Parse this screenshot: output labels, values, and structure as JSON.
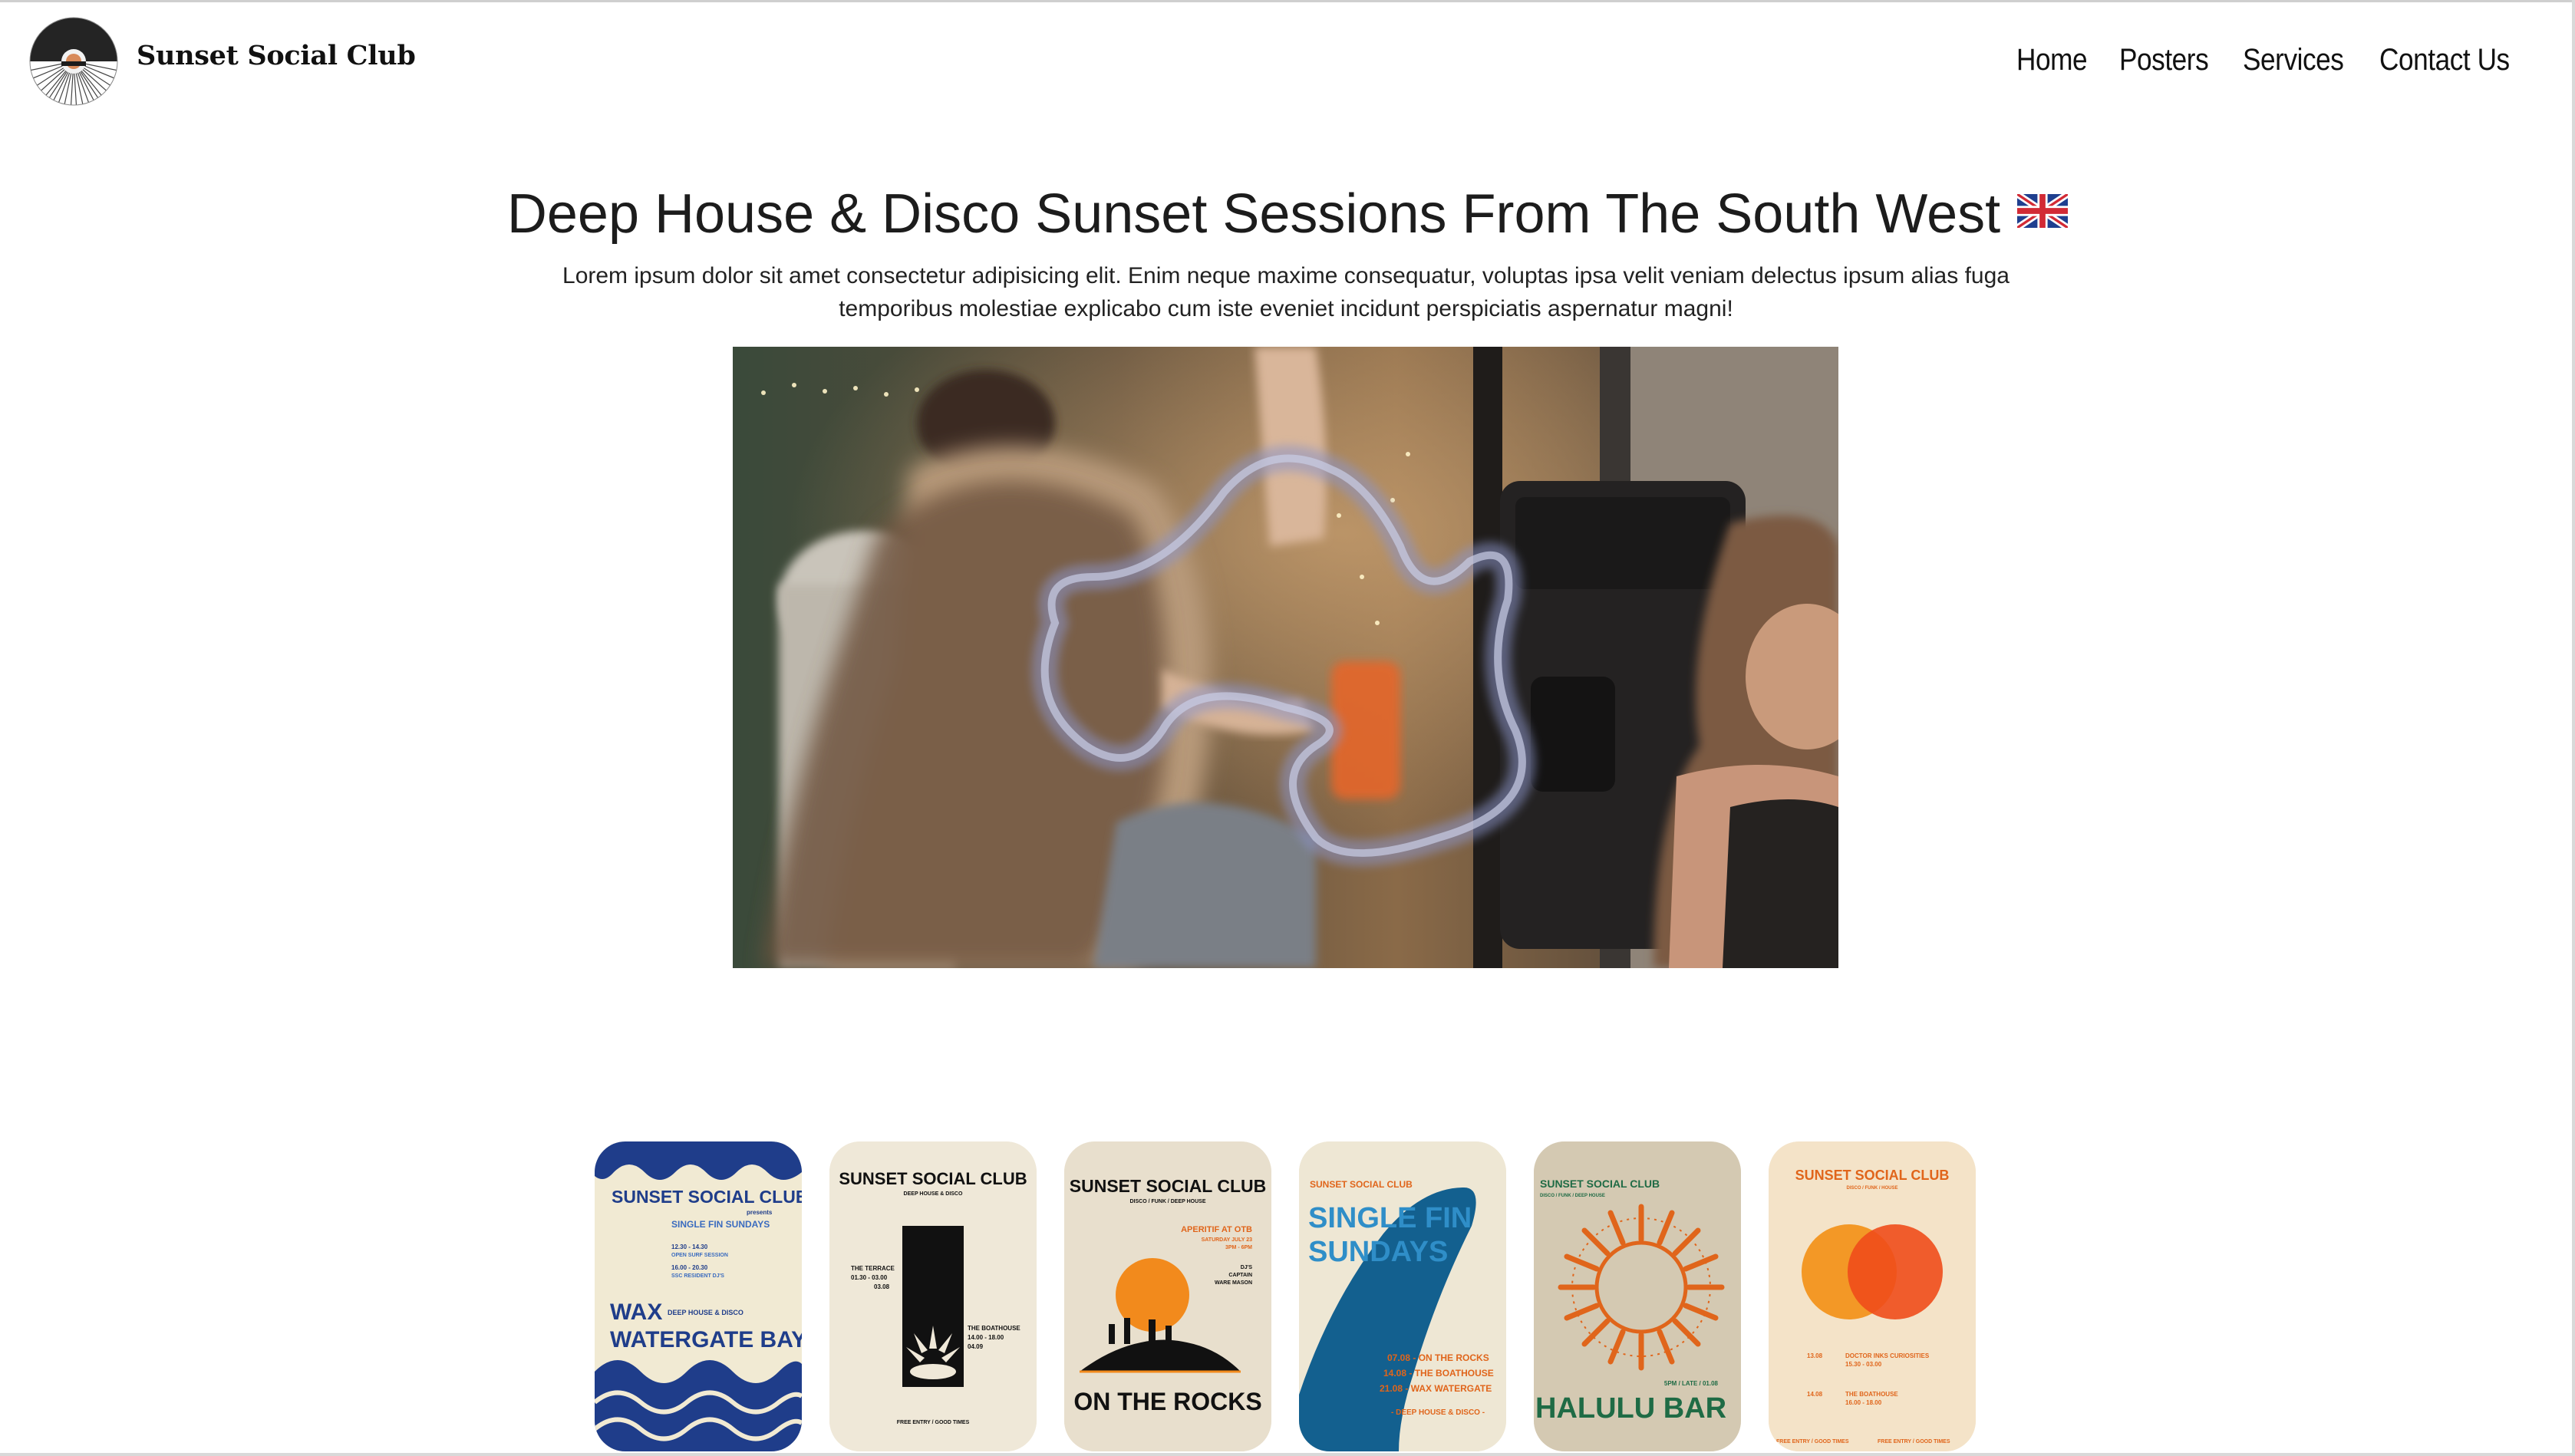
{
  "header": {
    "brand": "Sunset Social Club",
    "nav": [
      "Home",
      "Posters",
      "Services",
      "Contact Us"
    ]
  },
  "hero": {
    "title": "Deep House & Disco Sunset Sessions From The South West",
    "flag_icon": "uk-flag-icon",
    "lead": "Lorem ipsum dolor sit amet consectetur adipisicing elit. Enim neque maxime consequatur, voluptas ipsa velit veniam delectus ipsum alias fuga temporibus molestiae explicabo cum iste eveniet incidunt perspiciatis aspernatur magni!"
  },
  "posters": [
    {
      "brand": "SUNSET SOCIAL CLUB",
      "presents": "presents",
      "series": "SINGLE FIN SUNDAYS",
      "line1": "12.30 - 14.30",
      "line2": "OPEN SURF SESSION",
      "line3": "16.00 - 20.30",
      "line4": "SSC RESIDENT DJ'S",
      "genre": "DEEP HOUSE & DISCO",
      "venue_a": "WAX",
      "venue_b": "WATERGATE BAY"
    },
    {
      "brand": "SUNSET SOCIAL CLUB",
      "genre": "DEEP HOUSE & DISCO",
      "left_venue": "THE TERRACE",
      "left_time": "01.30 - 03.00",
      "left_date": "03.08",
      "right_venue": "THE BOATHOUSE",
      "right_time": "14.00 - 18.00",
      "right_date": "04.09",
      "footer": "FREE ENTRY / GOOD TIMES"
    },
    {
      "brand": "SUNSET SOCIAL CLUB",
      "genre": "DISCO / FUNK / DEEP HOUSE",
      "event": "APERITIF AT OTB",
      "date": "SATURDAY JULY 23",
      "time": "3PM - 6PM",
      "djs": "DJ'S",
      "dj1": "CAPTAIN",
      "dj2": "WARE MASON",
      "venue": "ON THE ROCKS"
    },
    {
      "brand": "SUNSET SOCIAL CLUB",
      "headline_a": "SINGLE FIN",
      "headline_b": "SUNDAYS",
      "date1": "07.08 - ON THE ROCKS",
      "date2": "14.08 - THE BOATHOUSE",
      "date3": "21.08 - WAX WATERGATE",
      "genre": "- DEEP HOUSE & DISCO -"
    },
    {
      "brand": "SUNSET SOCIAL CLUB",
      "genre": "DISCO / FUNK / DEEP HOUSE",
      "time": "5PM / LATE / 01.08",
      "venue": "HALULU BAR"
    },
    {
      "brand": "SUNSET SOCIAL CLUB",
      "genre": "DISCO / FUNK / HOUSE",
      "date1": "13.08",
      "event1": "DOCTOR INKS CURIOSITIES",
      "time1": "15.30 - 03.00",
      "date2": "14.08",
      "event2": "THE BOATHOUSE",
      "time2": "16.00 - 18.00",
      "footer_a": "FREE ENTRY / GOOD TIMES",
      "footer_b": "FREE ENTRY / GOOD TIMES"
    }
  ]
}
